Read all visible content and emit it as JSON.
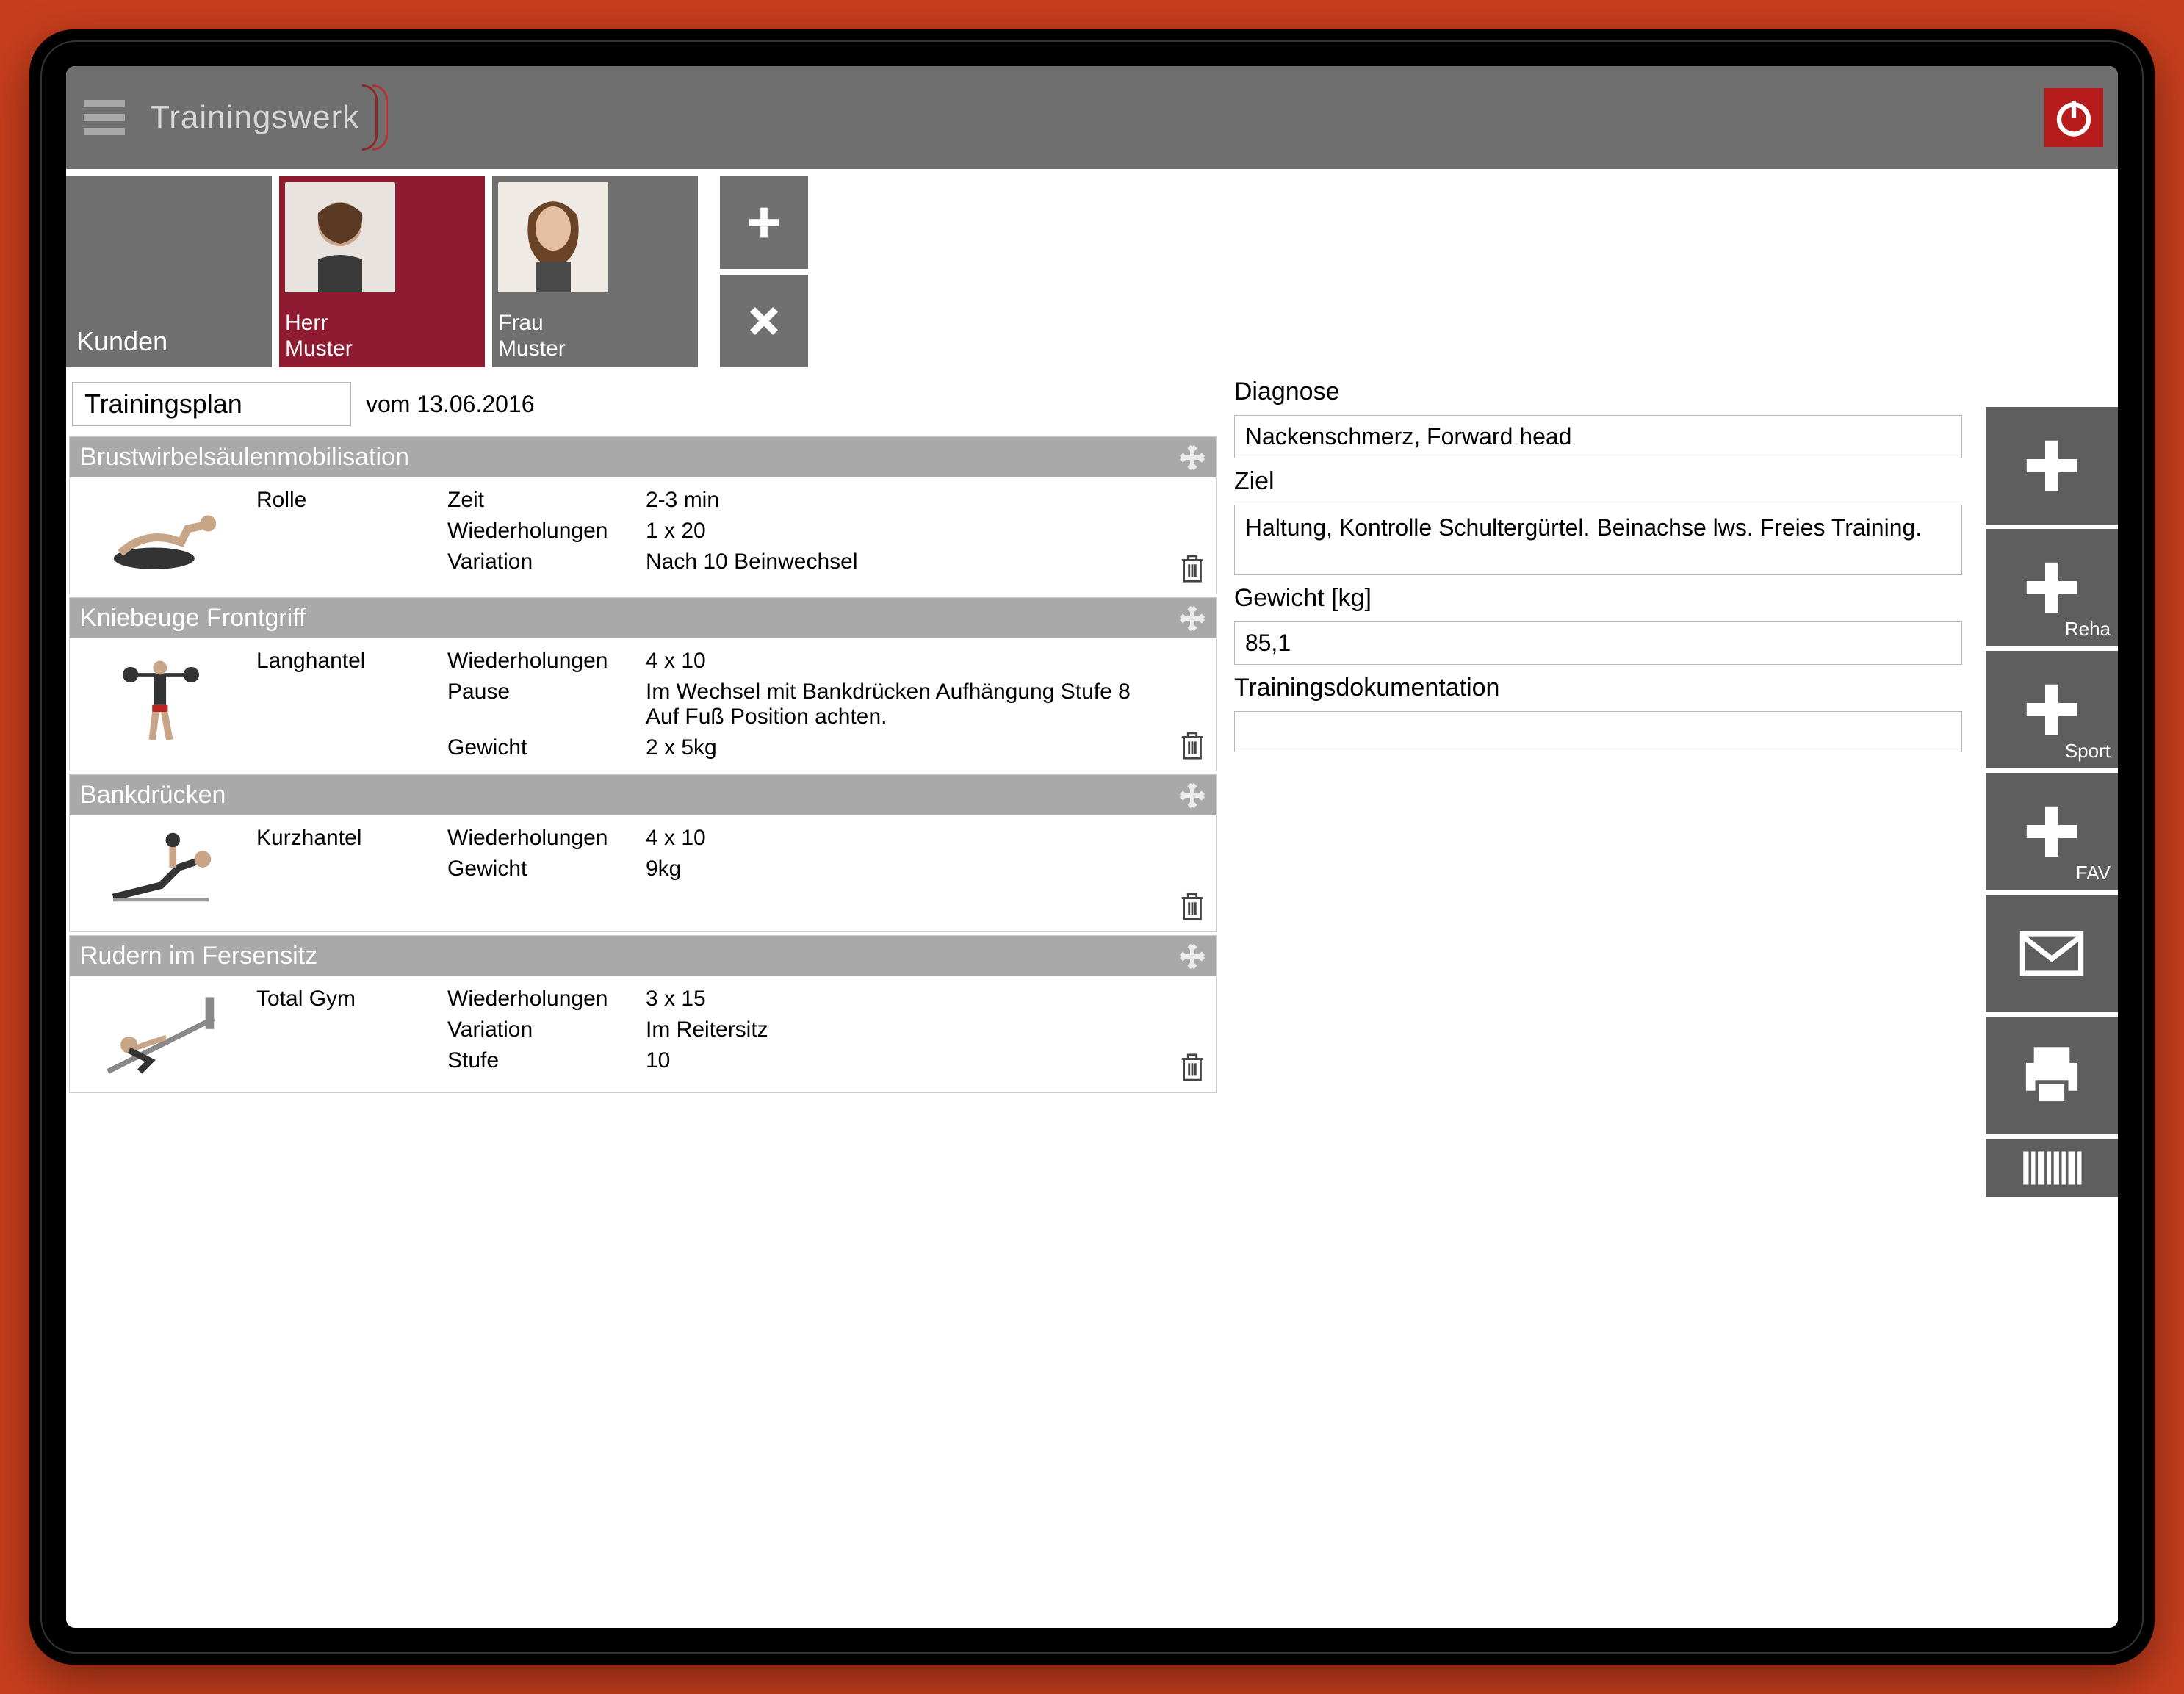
{
  "brand": "Trainingswerk",
  "kunden_label": "Kunden",
  "customers": [
    {
      "title": "Herr",
      "name": "Muster",
      "selected": true
    },
    {
      "title": "Frau",
      "name": "Muster",
      "selected": false
    }
  ],
  "plan": {
    "title": "Trainingsplan",
    "date_prefix": "vom",
    "date": "13.06.2016"
  },
  "exercises": [
    {
      "name": "Brustwirbelsäulenmobilisation",
      "equipment": "Rolle",
      "params": [
        {
          "label": "Zeit",
          "value": "2-3 min"
        },
        {
          "label": "Wiederholungen",
          "value": "1 x 20"
        },
        {
          "label": "Variation",
          "value": "Nach 10 Beinwechsel"
        }
      ]
    },
    {
      "name": "Kniebeuge Frontgriff",
      "equipment": "Langhantel",
      "params": [
        {
          "label": "Wiederholungen",
          "value": "4 x 10"
        },
        {
          "label": "Pause",
          "value": "Im Wechsel mit Bankdrücken Aufhängung Stufe 8 Auf Fuß Position achten."
        },
        {
          "label": "Gewicht",
          "value": "2 x 5kg"
        }
      ]
    },
    {
      "name": "Bankdrücken",
      "equipment": "Kurzhantel",
      "params": [
        {
          "label": "Wiederholungen",
          "value": "4 x 10"
        },
        {
          "label": "Gewicht",
          "value": "9kg"
        }
      ]
    },
    {
      "name": "Rudern im Fersensitz",
      "equipment": "Total Gym",
      "params": [
        {
          "label": "Wiederholungen",
          "value": "3 x 15"
        },
        {
          "label": "Variation",
          "value": "Im Reitersitz"
        },
        {
          "label": "Stufe",
          "value": "10"
        }
      ]
    }
  ],
  "info": {
    "diagnose_label": "Diagnose",
    "diagnose_value": "Nackenschmerz, Forward head",
    "ziel_label": "Ziel",
    "ziel_value": "Haltung, Kontrolle Schultergürtel. Beinachse lws. Freies Training.",
    "gewicht_label": "Gewicht [kg]",
    "gewicht_value": "85,1",
    "doku_label": "Trainingsdokumentation",
    "doku_value": ""
  },
  "sidebar": {
    "reha": "Reha",
    "sport": "Sport",
    "fav": "FAV"
  }
}
